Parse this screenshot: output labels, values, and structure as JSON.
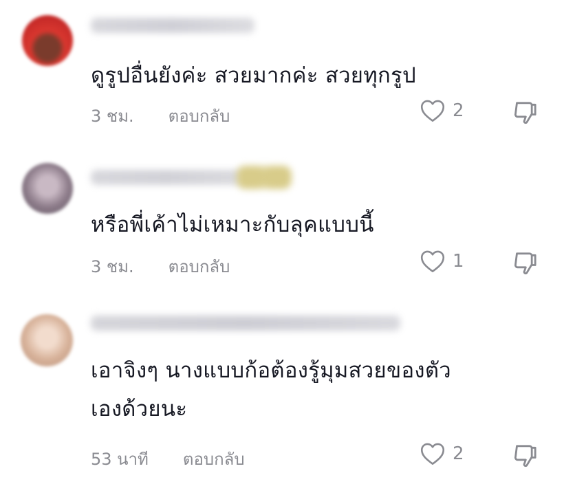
{
  "comments": [
    {
      "text_lines": [
        "ดูรูปอื่นยังค่ะ สวยมากค่ะ สวยทุกรูป"
      ],
      "time": "3 ชม.",
      "reply_label": "ตอบกลับ",
      "likes": "2",
      "avatar_color": "#c8312e"
    },
    {
      "text_lines": [
        "หรือพี่เค้าไม่เหมาะกับลุคแบบนี้"
      ],
      "time": "3 ชม.",
      "reply_label": "ตอบกลับ",
      "likes": "1",
      "avatar_color": "#7a6a78"
    },
    {
      "text_lines": [
        "เอาจิงๆ นางแบบก้อต้องรู้มุมสวยของตัว",
        "เองด้วยนะ"
      ],
      "time": "53 นาที",
      "reply_label": "ตอบกลับ",
      "likes": "2",
      "avatar_color": "#d9b6a0"
    }
  ],
  "icons": {
    "like": "heart-outline-icon",
    "dislike": "thumbs-down-outline-icon"
  },
  "colors": {
    "text": "#161823",
    "muted": "#8a8b91",
    "background": "#ffffff"
  }
}
